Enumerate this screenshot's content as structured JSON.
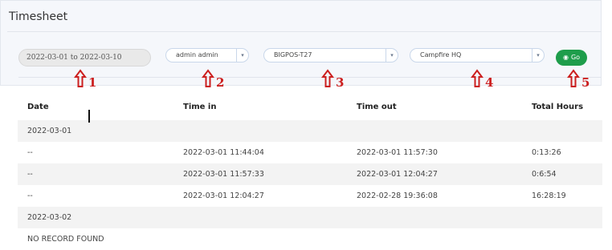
{
  "header": {
    "title": "Timesheet"
  },
  "filters": {
    "date_range": "2022-03-01 to 2022-03-10",
    "user_select": "admin admin",
    "device_select": "BIGPOS-T27",
    "location_select": "Campfire HQ",
    "go_label": "Go"
  },
  "markers": [
    "1",
    "2",
    "3",
    "4",
    "5"
  ],
  "table": {
    "columns": {
      "date": "Date",
      "time_in": "Time in",
      "time_out": "Time out",
      "total_hours": "Total Hours"
    },
    "rows": [
      {
        "date": "2022-03-01",
        "time_in": "",
        "time_out": "",
        "total_hours": ""
      },
      {
        "date": "--",
        "time_in": "2022-03-01 11:44:04",
        "time_out": "2022-03-01 11:57:30",
        "total_hours": "0:13:26"
      },
      {
        "date": "--",
        "time_in": "2022-03-01 11:57:33",
        "time_out": "2022-03-01 12:04:27",
        "total_hours": "0:6:54"
      },
      {
        "date": "--",
        "time_in": "2022-03-01 12:04:27",
        "time_out": "2022-02-28 19:36:08",
        "total_hours": "16:28:19"
      },
      {
        "date": "2022-03-02",
        "time_in": "",
        "time_out": "",
        "total_hours": ""
      },
      {
        "date": "NO RECORD FOUND",
        "time_in": "",
        "time_out": "",
        "total_hours": ""
      }
    ]
  },
  "colors": {
    "go_button": "#1e9d4b",
    "marker": "#cc1f1f",
    "row_shade": "#f3f3f3"
  }
}
